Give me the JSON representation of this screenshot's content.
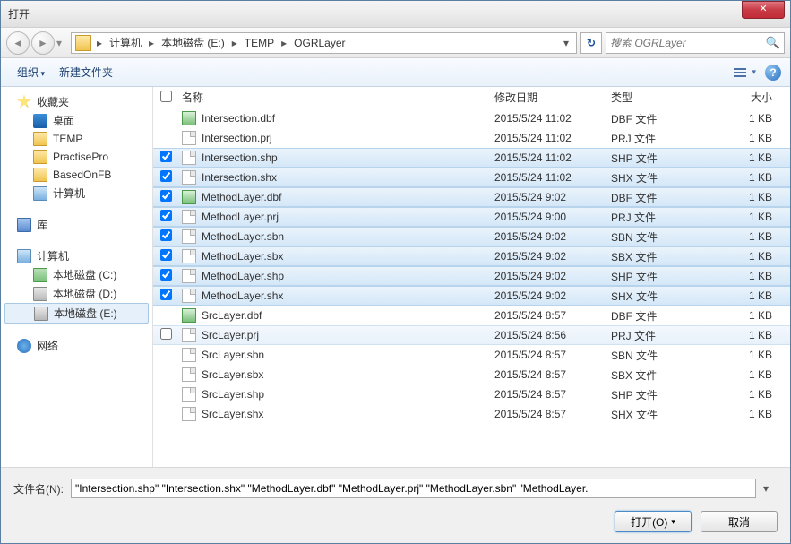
{
  "window": {
    "title": "打开"
  },
  "breadcrumb": {
    "segments": [
      "计算机",
      "本地磁盘 (E:)",
      "TEMP",
      "OGRLayer"
    ]
  },
  "search": {
    "placeholder": "搜索 OGRLayer"
  },
  "toolbar": {
    "organize": "组织",
    "newfolder": "新建文件夹"
  },
  "sidebar": {
    "favorites": {
      "label": "收藏夹",
      "items": [
        "桌面",
        "TEMP",
        "PractisePro",
        "BasedOnFB",
        "计算机"
      ]
    },
    "library": {
      "label": "库"
    },
    "computer": {
      "label": "计算机",
      "items": [
        "本地磁盘 (C:)",
        "本地磁盘 (D:)",
        "本地磁盘 (E:)"
      ]
    },
    "network": {
      "label": "网络"
    }
  },
  "columns": {
    "name": "名称",
    "date": "修改日期",
    "type": "类型",
    "size": "大小"
  },
  "files": [
    {
      "name": "Intersection.dbf",
      "date": "2015/5/24 11:02",
      "type": "DBF 文件",
      "size": "1 KB",
      "icon": "dbf",
      "checked": false,
      "selected": false,
      "showCb": false
    },
    {
      "name": "Intersection.prj",
      "date": "2015/5/24 11:02",
      "type": "PRJ 文件",
      "size": "1 KB",
      "icon": "generic",
      "checked": false,
      "selected": false,
      "showCb": false
    },
    {
      "name": "Intersection.shp",
      "date": "2015/5/24 11:02",
      "type": "SHP 文件",
      "size": "1 KB",
      "icon": "generic",
      "checked": true,
      "selected": true,
      "showCb": true
    },
    {
      "name": "Intersection.shx",
      "date": "2015/5/24 11:02",
      "type": "SHX 文件",
      "size": "1 KB",
      "icon": "generic",
      "checked": true,
      "selected": true,
      "showCb": true
    },
    {
      "name": "MethodLayer.dbf",
      "date": "2015/5/24 9:02",
      "type": "DBF 文件",
      "size": "1 KB",
      "icon": "dbf",
      "checked": true,
      "selected": true,
      "showCb": true
    },
    {
      "name": "MethodLayer.prj",
      "date": "2015/5/24 9:00",
      "type": "PRJ 文件",
      "size": "1 KB",
      "icon": "generic",
      "checked": true,
      "selected": true,
      "showCb": true
    },
    {
      "name": "MethodLayer.sbn",
      "date": "2015/5/24 9:02",
      "type": "SBN 文件",
      "size": "1 KB",
      "icon": "generic",
      "checked": true,
      "selected": true,
      "showCb": true
    },
    {
      "name": "MethodLayer.sbx",
      "date": "2015/5/24 9:02",
      "type": "SBX 文件",
      "size": "1 KB",
      "icon": "generic",
      "checked": true,
      "selected": true,
      "showCb": true
    },
    {
      "name": "MethodLayer.shp",
      "date": "2015/5/24 9:02",
      "type": "SHP 文件",
      "size": "1 KB",
      "icon": "generic",
      "checked": true,
      "selected": true,
      "showCb": true
    },
    {
      "name": "MethodLayer.shx",
      "date": "2015/5/24 9:02",
      "type": "SHX 文件",
      "size": "1 KB",
      "icon": "generic",
      "checked": true,
      "selected": true,
      "showCb": true
    },
    {
      "name": "SrcLayer.dbf",
      "date": "2015/5/24 8:57",
      "type": "DBF 文件",
      "size": "1 KB",
      "icon": "dbf",
      "checked": false,
      "selected": false,
      "showCb": false
    },
    {
      "name": "SrcLayer.prj",
      "date": "2015/5/24 8:56",
      "type": "PRJ 文件",
      "size": "1 KB",
      "icon": "generic",
      "checked": false,
      "selected": false,
      "showCb": true,
      "hover": true
    },
    {
      "name": "SrcLayer.sbn",
      "date": "2015/5/24 8:57",
      "type": "SBN 文件",
      "size": "1 KB",
      "icon": "generic",
      "checked": false,
      "selected": false,
      "showCb": false
    },
    {
      "name": "SrcLayer.sbx",
      "date": "2015/5/24 8:57",
      "type": "SBX 文件",
      "size": "1 KB",
      "icon": "generic",
      "checked": false,
      "selected": false,
      "showCb": false
    },
    {
      "name": "SrcLayer.shp",
      "date": "2015/5/24 8:57",
      "type": "SHP 文件",
      "size": "1 KB",
      "icon": "generic",
      "checked": false,
      "selected": false,
      "showCb": false
    },
    {
      "name": "SrcLayer.shx",
      "date": "2015/5/24 8:57",
      "type": "SHX 文件",
      "size": "1 KB",
      "icon": "generic",
      "checked": false,
      "selected": false,
      "showCb": false
    }
  ],
  "footer": {
    "filename_label": "文件名(N):",
    "filename_value": "\"Intersection.shp\" \"Intersection.shx\" \"MethodLayer.dbf\" \"MethodLayer.prj\" \"MethodLayer.sbn\" \"MethodLayer.",
    "open": "打开(O)",
    "cancel": "取消"
  }
}
